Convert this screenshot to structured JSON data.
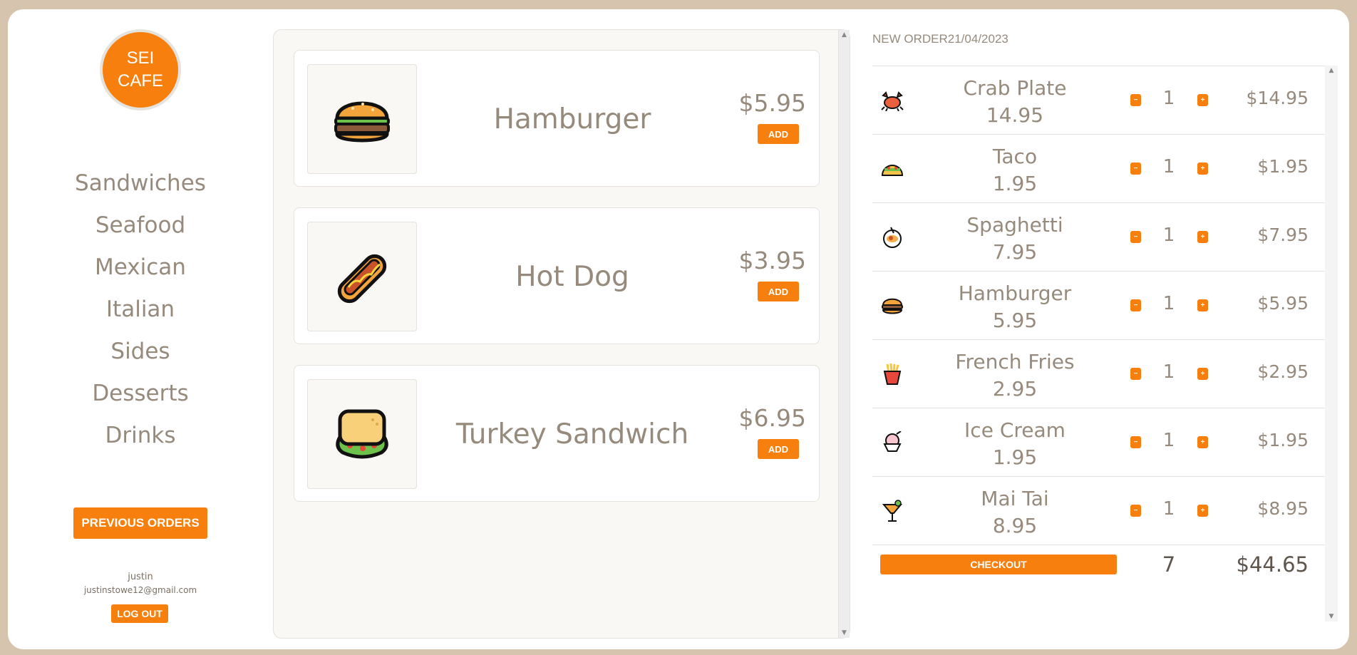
{
  "brand": {
    "line1": "SEI",
    "line2": "CAFE",
    "accent": "#f67f0d"
  },
  "sidebar": {
    "categories": [
      "Sandwiches",
      "Seafood",
      "Mexican",
      "Italian",
      "Sides",
      "Desserts",
      "Drinks"
    ],
    "previous_orders_label": "PREVIOUS ORDERS",
    "user_name": "justin",
    "user_email": "justinstowe12@gmail.com",
    "logout_label": "LOG OUT"
  },
  "menu": {
    "items": [
      {
        "name": "Hamburger",
        "price": "$5.95",
        "add_label": "ADD",
        "icon": "hamburger-icon"
      },
      {
        "name": "Hot Dog",
        "price": "$3.95",
        "add_label": "ADD",
        "icon": "hotdog-icon"
      },
      {
        "name": "Turkey Sandwich",
        "price": "$6.95",
        "add_label": "ADD",
        "icon": "sandwich-icon"
      }
    ]
  },
  "order": {
    "title": "NEW ORDER21/04/2023",
    "items": [
      {
        "name": "Crab Plate",
        "unit": "14.95",
        "qty": "1",
        "total": "$14.95",
        "icon": "crab-icon"
      },
      {
        "name": "Taco",
        "unit": "1.95",
        "qty": "1",
        "total": "$1.95",
        "icon": "taco-icon"
      },
      {
        "name": "Spaghetti",
        "unit": "7.95",
        "qty": "1",
        "total": "$7.95",
        "icon": "spaghetti-icon"
      },
      {
        "name": "Hamburger",
        "unit": "5.95",
        "qty": "1",
        "total": "$5.95",
        "icon": "hamburger-icon"
      },
      {
        "name": "French Fries",
        "unit": "2.95",
        "qty": "1",
        "total": "$2.95",
        "icon": "fries-icon"
      },
      {
        "name": "Ice Cream",
        "unit": "1.95",
        "qty": "1",
        "total": "$1.95",
        "icon": "ice-cream-icon"
      },
      {
        "name": "Mai Tai",
        "unit": "8.95",
        "qty": "1",
        "total": "$8.95",
        "icon": "cocktail-icon"
      }
    ],
    "minus_label": "−",
    "plus_label": "+",
    "checkout_label": "CHECKOUT",
    "total_qty": "7",
    "total_price": "$44.65"
  }
}
